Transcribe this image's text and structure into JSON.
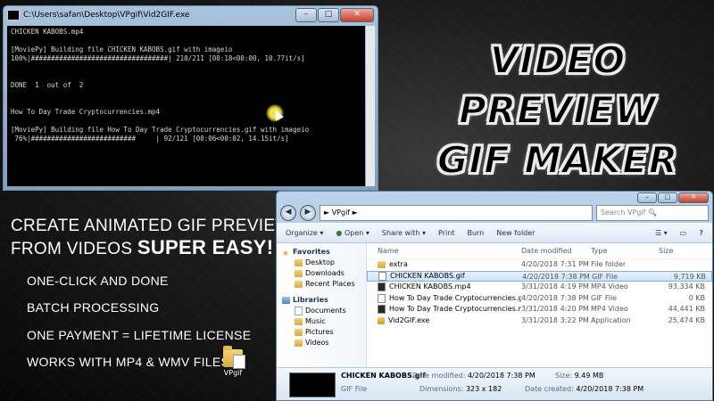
{
  "console": {
    "title": "C:\\Users\\safan\\Desktop\\VPgif\\Vid2GIF.exe",
    "lines": [
      "CHICKEN KABOBS.mp4",
      "",
      "[MoviePy] Building file CHICKEN KABOBS.gif with imageio",
      "100%|##################################| 210/211 [00:18<00:00, 10.77it/s]",
      "",
      "",
      "DONE  1  out of  2",
      "",
      "",
      "How To Day Trade Cryptocurrencies.mp4",
      "",
      "[MoviePy] Building file How To Day Trade Cryptocurrencies.gif with imageio",
      " 76%|##########################     | 92/121 [00:06<00:02, 14.15it/s]"
    ]
  },
  "hero_title": {
    "line1": "VIDEO PREVIEW",
    "line2": "GIF MAKER"
  },
  "marketing": {
    "headline_line1": "CREATE ANIMATED GIF PREVIEWS",
    "headline_line2_a": "FROM VIDEOS ",
    "headline_line2_b": "SUPER EASY!",
    "features": [
      "ONE-CLICK AND DONE",
      "BATCH PROCESSING",
      "ONE PAYMENT = LIFETIME LICENSE",
      "WORKS WITH MP4 & WMV FILES"
    ],
    "desktop_icon_label": "VPgif"
  },
  "explorer": {
    "address": "VPgif",
    "search_placeholder": "Search VPgif",
    "toolbar": [
      "Organize",
      "Open",
      "Share with",
      "Print",
      "Burn",
      "New folder"
    ],
    "nav": [
      {
        "label": "Favorites",
        "kind": "group"
      },
      {
        "label": "Desktop",
        "kind": "sub"
      },
      {
        "label": "Downloads",
        "kind": "sub"
      },
      {
        "label": "Recent Places",
        "kind": "sub"
      },
      {
        "label": "Libraries",
        "kind": "group"
      },
      {
        "label": "Documents",
        "kind": "sub"
      },
      {
        "label": "Music",
        "kind": "sub"
      },
      {
        "label": "Pictures",
        "kind": "sub"
      },
      {
        "label": "Videos",
        "kind": "sub"
      }
    ],
    "columns": {
      "name": "Name",
      "date": "Date modified",
      "type": "Type",
      "size": "Size"
    },
    "files": [
      {
        "name": "extra",
        "date": "4/20/2018 7:31 PM",
        "type": "File folder",
        "size": "",
        "icon": "folder-icon"
      },
      {
        "name": "CHICKEN KABOBS.gif",
        "date": "4/20/2018 7:38 PM",
        "type": "GIF File",
        "size": "9,719 KB",
        "icon": "gif-file-icon",
        "selected": true
      },
      {
        "name": "CHICKEN KABOBS.mp4",
        "date": "3/31/2018 4:19 PM",
        "type": "MP4 Video",
        "size": "93,334 KB",
        "icon": "video-file-icon"
      },
      {
        "name": "How To Day Trade Cryptocurrencies.gif",
        "date": "4/20/2018 7:38 PM",
        "type": "GIF File",
        "size": "0 KB",
        "icon": "gif-file-icon"
      },
      {
        "name": "How To Day Trade Cryptocurrencies.mp4",
        "date": "3/31/2018 4:20 PM",
        "type": "MP4 Video",
        "size": "44,441 KB",
        "icon": "video-file-icon"
      },
      {
        "name": "Vid2GIF.exe",
        "date": "3/31/2018 3:22 PM",
        "type": "Application",
        "size": "25,474 KB",
        "icon": "exe-file-icon"
      }
    ],
    "details": {
      "name": "CHICKEN KABOBS.gif",
      "type": "GIF File",
      "date_modified_label": "Date modified:",
      "date_modified": "4/20/2018 7:38 PM",
      "size_label": "Size:",
      "size": "9.49 MB",
      "dimensions_label": "Dimensions:",
      "dimensions": "323 x 182",
      "date_created_label": "Date created:",
      "date_created": "4/20/2018 7:38 PM"
    }
  }
}
